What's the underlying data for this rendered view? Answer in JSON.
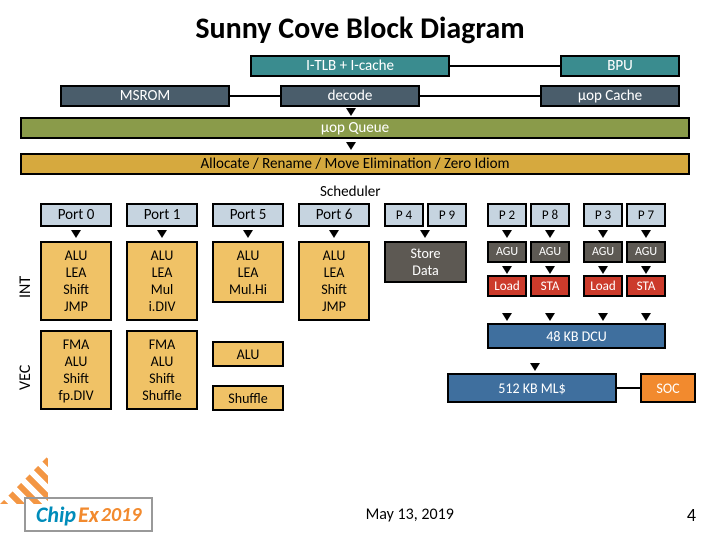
{
  "title": "Sunny Cove Block Diagram",
  "top": {
    "itlb": "I-TLB + I-cache",
    "bpu": "BPU",
    "msrom": "MSROM",
    "decode": "decode",
    "uopcache": "µop Cache",
    "uopqueue": "µop Queue",
    "allocate": "Allocate / Rename / Move Elimination / Zero Idiom"
  },
  "scheduler_label": "Scheduler",
  "ports": [
    "Port 0",
    "Port 1",
    "Port 5",
    "Port 6",
    "P 4",
    "P 9",
    "P 2",
    "P 8",
    "P 3",
    "P 7"
  ],
  "int_label": "INT",
  "vec_label": "VEC",
  "int_blocks": [
    "ALU\nLEA\nShift\nJMP",
    "ALU\nLEA\nMul\ni.DIV",
    "ALU\nLEA\nMul.Hi",
    "ALU\nLEA\nShift\nJMP"
  ],
  "store_data": "Store\nData",
  "agu": "AGU",
  "load_sta": [
    "Load",
    "STA",
    "Load",
    "STA"
  ],
  "vec_blocks": [
    "FMA\nALU\nShift\nfp.DIV",
    "FMA\nALU\nShift\nShuffle",
    "ALU",
    "Shuffle"
  ],
  "dcu": "48 KB DCU",
  "ml": "512 KB ML$",
  "soc": "SOC",
  "footer": {
    "date": "May 13, 2019",
    "slide": "4",
    "logo_a": "Chip",
    "logo_b": "Ex",
    "logo_year": "2019"
  }
}
